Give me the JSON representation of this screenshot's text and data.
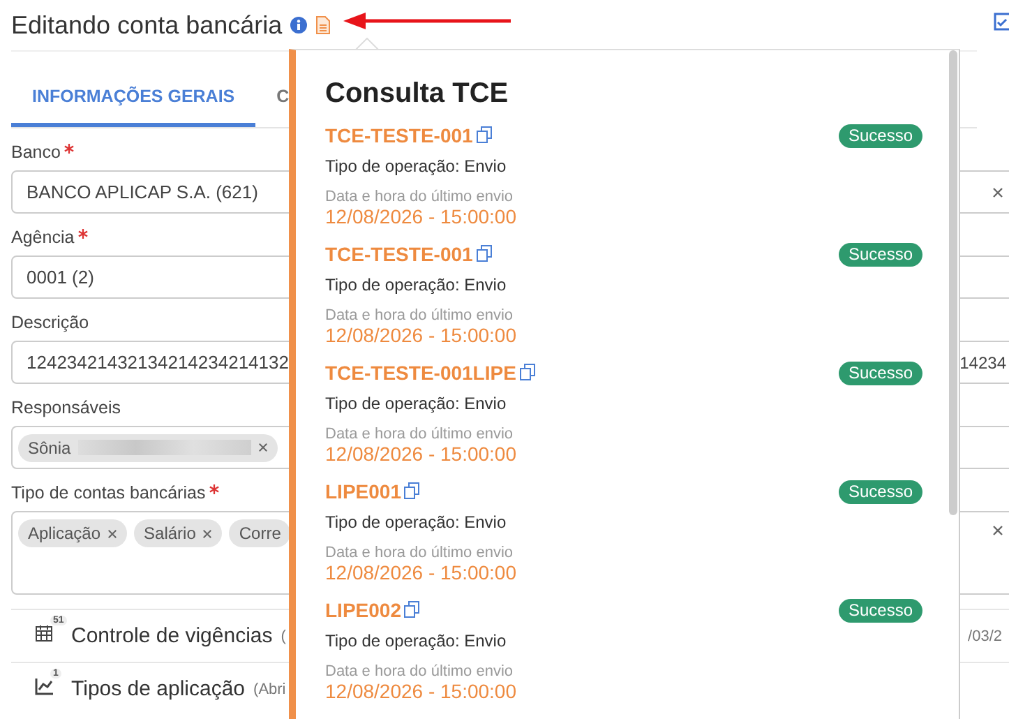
{
  "header": {
    "title": "Editando conta bancária"
  },
  "tabs": [
    {
      "label": "INFORMAÇÕES GERAIS",
      "selected": true
    },
    {
      "label": "C",
      "selected": false
    }
  ],
  "fields": [
    {
      "label": "Banco",
      "required": true,
      "kind": "text",
      "value": "BANCO APLICAP S.A. (621)",
      "clearable": true
    },
    {
      "label": "Agência",
      "required": true,
      "kind": "text",
      "value": "0001 (2)",
      "clearable": false
    },
    {
      "label": "Descrição",
      "required": false,
      "kind": "text",
      "value": "12423421432134214234214132",
      "value_end": "14234",
      "clearable": false
    },
    {
      "label": "Responsáveis",
      "required": false,
      "kind": "chips",
      "clearable": false,
      "chips": [
        {
          "label": "Sônia",
          "redacted": true,
          "removable": true
        }
      ]
    },
    {
      "label": "Tipo de contas bancárias",
      "required": true,
      "kind": "chips",
      "tall": true,
      "clearable": true,
      "chips": [
        {
          "label": "Aplicação",
          "redacted": false,
          "removable": true
        },
        {
          "label": "Salário",
          "redacted": false,
          "removable": true
        },
        {
          "label": "Corre",
          "redacted": false,
          "removable": false
        }
      ]
    }
  ],
  "sections": [
    {
      "badge": "51",
      "label": "Controle de vigências",
      "hint": "(",
      "trailing": "/03/2"
    },
    {
      "badge": "1",
      "label": "Tipos de aplicação",
      "hint": "(Abri"
    }
  ],
  "popover": {
    "title": "Consulta TCE",
    "items": [
      {
        "code": "TCE-TESTE-001",
        "status": "Sucesso",
        "operation": "Tipo de operação: Envio",
        "date_label": "Data e hora do último envio",
        "date": "12/08/2026 - 15:00:00"
      },
      {
        "code": "TCE-TESTE-001",
        "status": "Sucesso",
        "operation": "Tipo de operação: Envio",
        "date_label": "Data e hora do último envio",
        "date": "12/08/2026 - 15:00:00"
      },
      {
        "code": "TCE-TESTE-001LIPE",
        "status": "Sucesso",
        "operation": "Tipo de operação: Envio",
        "date_label": "Data e hora do último envio",
        "date": "12/08/2026 - 15:00:00"
      },
      {
        "code": "LIPE001",
        "status": "Sucesso",
        "operation": "Tipo de operação: Envio",
        "date_label": "Data e hora do último envio",
        "date": "12/08/2026 - 15:00:00"
      },
      {
        "code": "LIPE002",
        "status": "Sucesso",
        "operation": "Tipo de operação: Envio",
        "date_label": "Data e hora do último envio",
        "date": "12/08/2026 - 15:00:00"
      }
    ]
  }
}
